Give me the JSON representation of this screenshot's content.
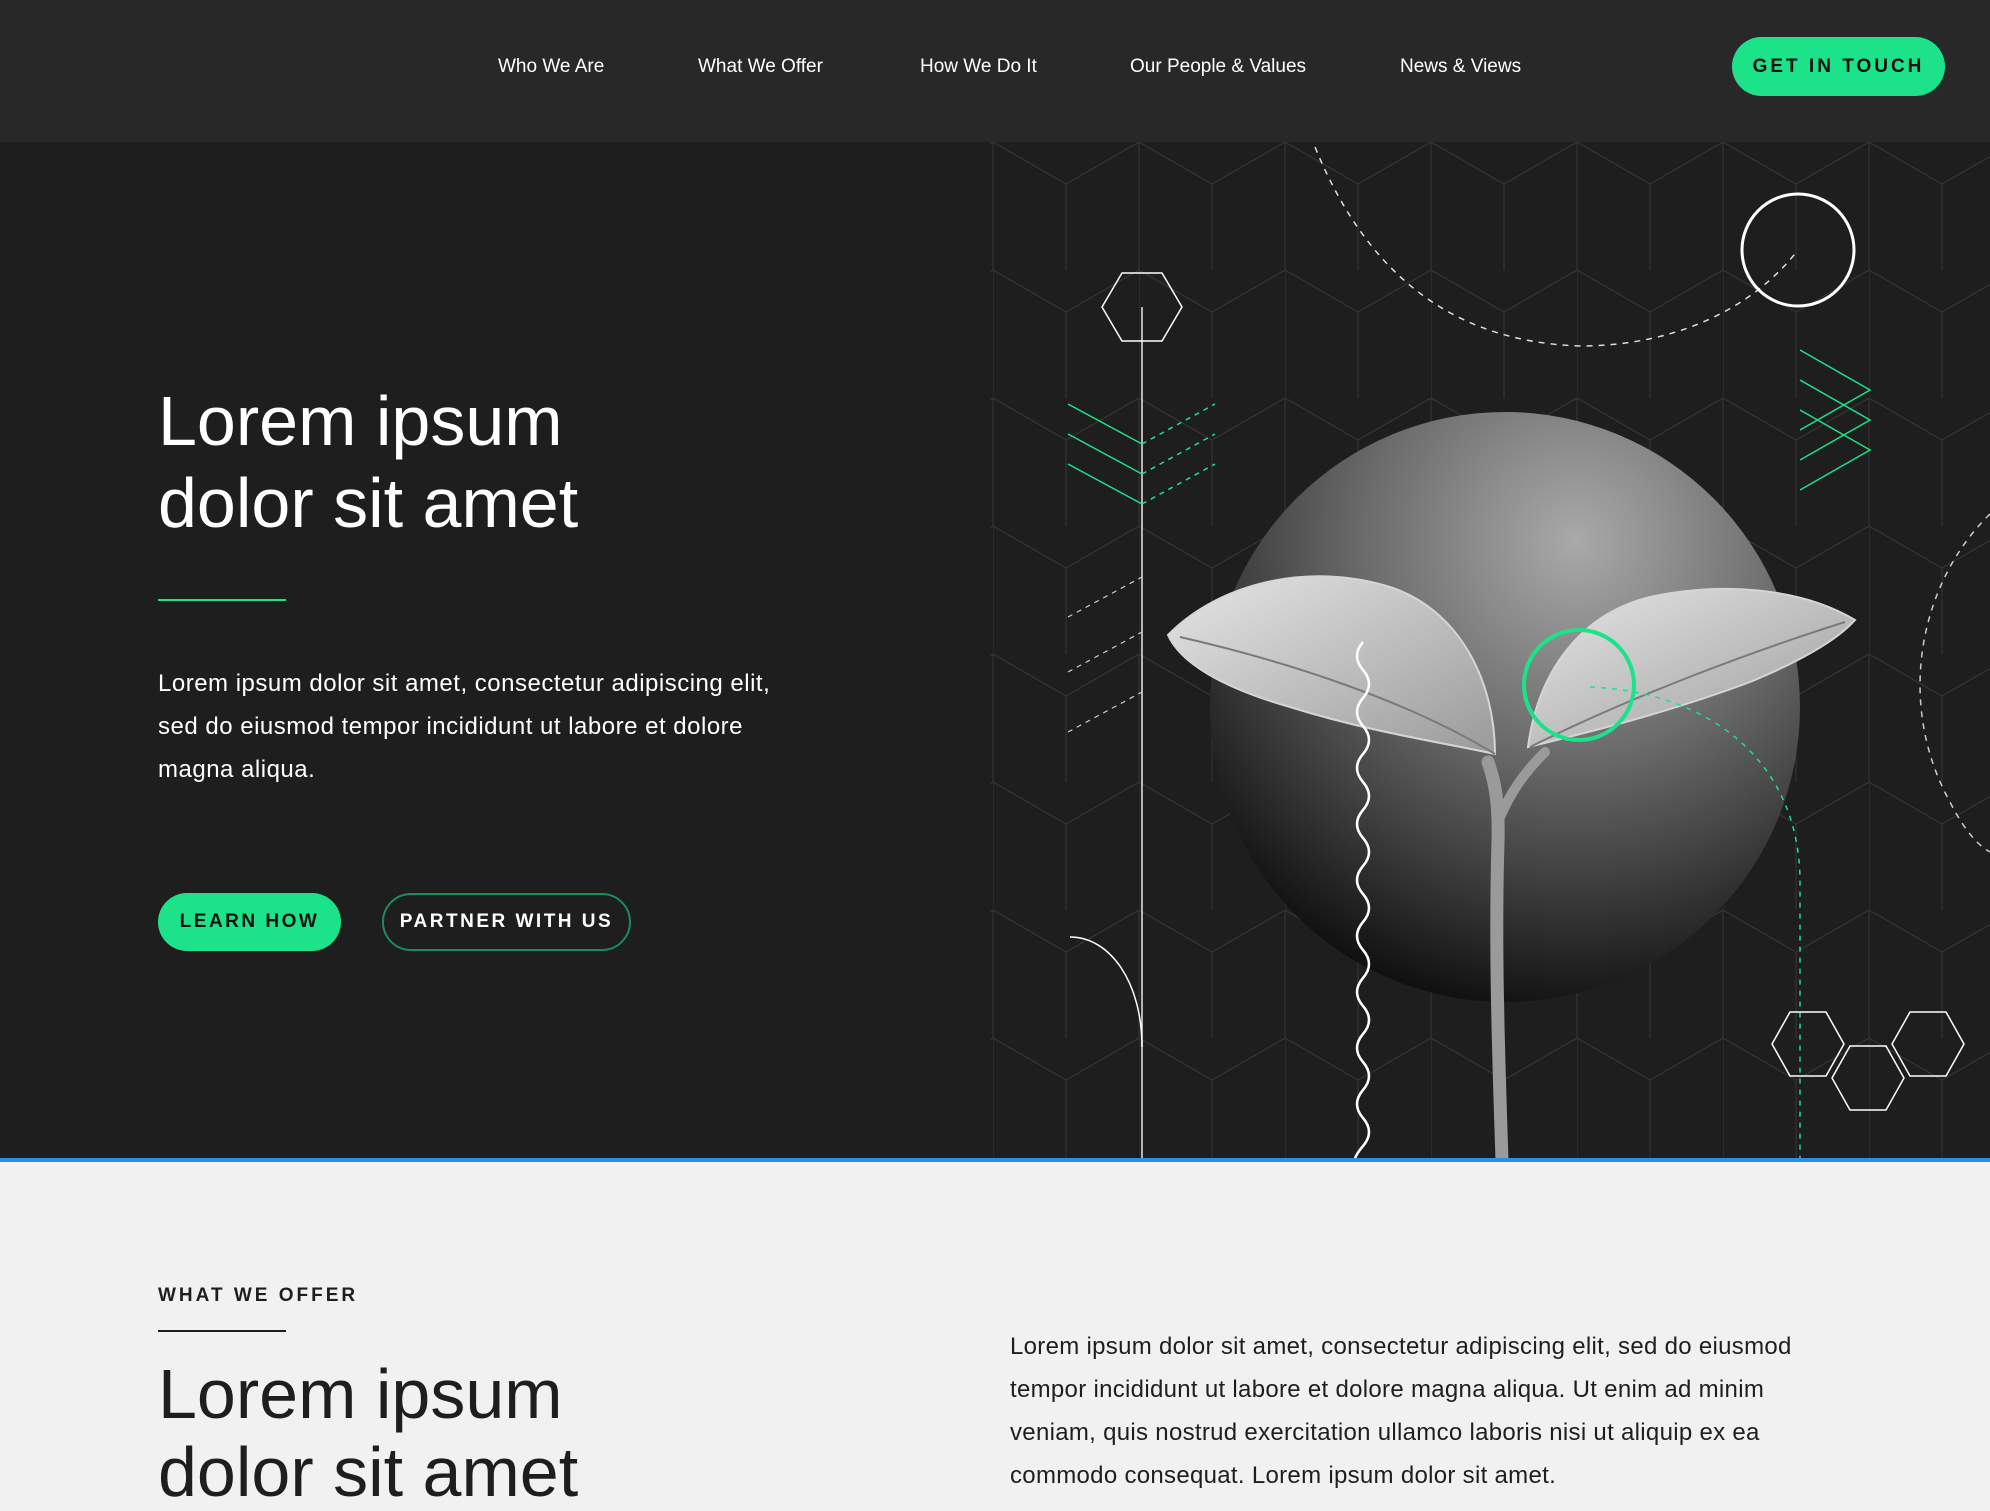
{
  "nav": {
    "links": [
      "Who We Are",
      "What We Offer",
      "How We Do It",
      "Our People & Values",
      "News & Views"
    ],
    "cta": "GET IN TOUCH"
  },
  "hero": {
    "title": "Lorem ipsum\ndolor sit amet",
    "text": "Lorem ipsum dolor sit amet, consectetur adipiscing elit, sed do eiusmod tempor incididunt ut labore et dolore magna aliqua.",
    "primary_button": "LEARN HOW",
    "secondary_button": "PARTNER WITH US"
  },
  "offer": {
    "eyebrow": "WHAT WE OFFER",
    "title": "Lorem ipsum\ndolor sit amet",
    "text": "Lorem ipsum dolor sit amet, consectetur adipiscing elit, sed do eiusmod tempor incididunt ut labore et dolore magna aliqua. Ut enim ad minim veniam, quis nostrud exercitation ullamco laboris nisi ut aliquip ex ea commodo consequat. Lorem ipsum dolor sit amet."
  },
  "colors": {
    "accent": "#1ce389",
    "nav_bg": "#282828",
    "hero_bg": "#1e1e1e",
    "divider": "#2a8ef0",
    "page_bg": "#f1f1f1"
  }
}
